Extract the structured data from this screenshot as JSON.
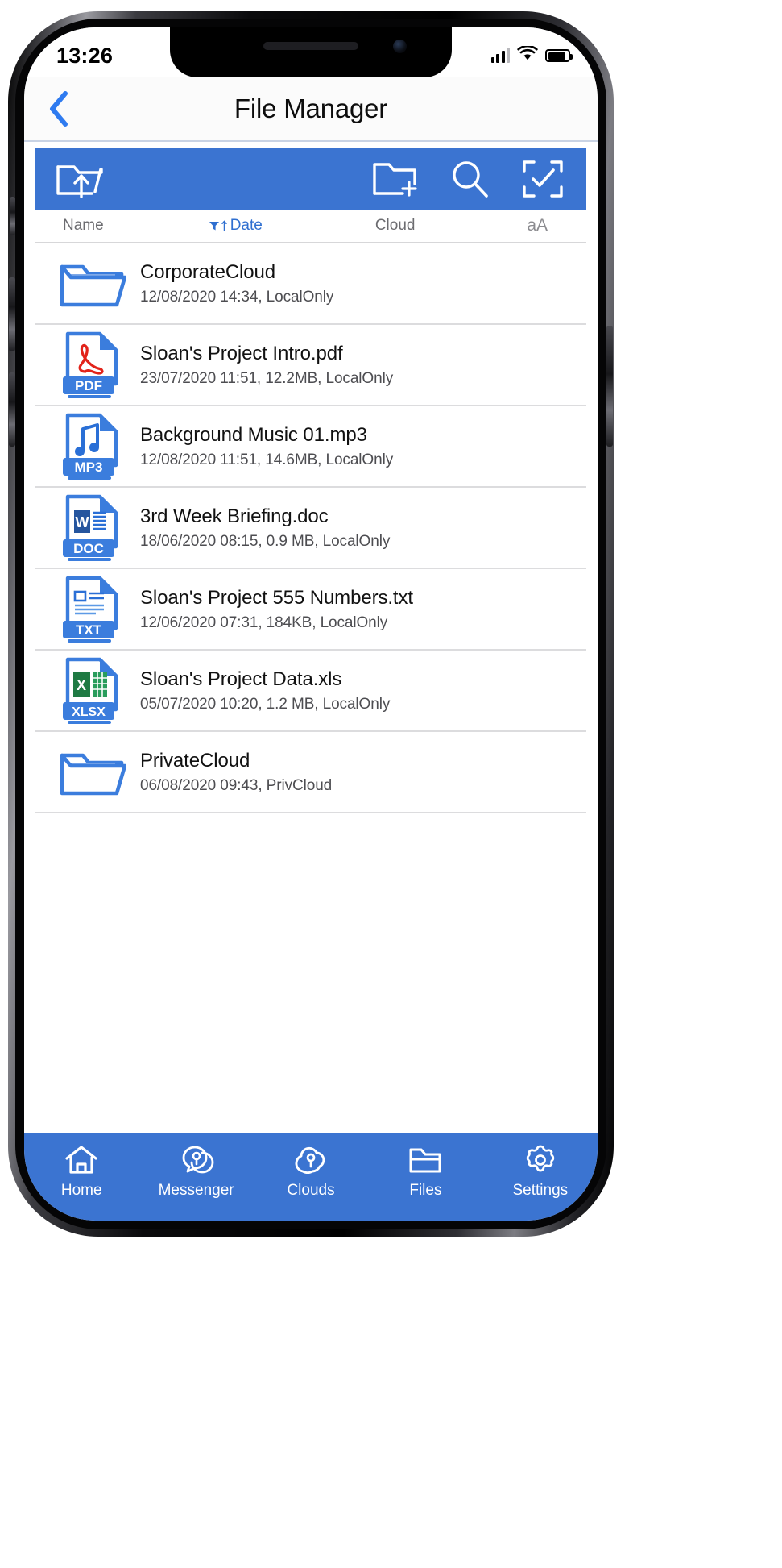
{
  "status_bar": {
    "time": "13:26",
    "signal_icon": "cellular-signal-icon",
    "wifi_icon": "wifi-icon",
    "battery_icon": "battery-icon"
  },
  "nav": {
    "back_icon": "chevron-left-icon",
    "title": "File Manager"
  },
  "toolbar": {
    "upload_label": "folder-upload-icon",
    "new_folder_label": "new-folder-icon",
    "search_label": "search-icon",
    "select_label": "select-all-icon"
  },
  "columns": {
    "name": "Name",
    "date": "Date",
    "cloud": "Cloud",
    "textsize": "aA",
    "sort_active": "date"
  },
  "files": [
    {
      "name": "CorporateCloud",
      "meta": "12/08/2020 14:34, LocalOnly",
      "icon": "folder-icon",
      "type": "folder",
      "date": "12/08/2020 14:34",
      "size": "",
      "cloud": "LocalOnly",
      "badge": ""
    },
    {
      "name": "Sloan's Project Intro.pdf",
      "meta": "23/07/2020 11:51, 12.2MB, LocalOnly",
      "icon": "pdf-file-icon",
      "type": "pdf",
      "date": "23/07/2020 11:51",
      "size": "12.2MB",
      "cloud": "LocalOnly",
      "badge": "PDF"
    },
    {
      "name": "Background Music 01.mp3",
      "meta": "12/08/2020 11:51, 14.6MB, LocalOnly",
      "icon": "mp3-file-icon",
      "type": "mp3",
      "date": "12/08/2020 11:51",
      "size": "14.6MB",
      "cloud": "LocalOnly",
      "badge": "MP3"
    },
    {
      "name": "3rd Week Briefing.doc",
      "meta": "18/06/2020 08:15, 0.9 MB, LocalOnly",
      "icon": "doc-file-icon",
      "type": "doc",
      "date": "18/06/2020 08:15",
      "size": "0.9 MB",
      "cloud": "LocalOnly",
      "badge": "DOC"
    },
    {
      "name": "Sloan's Project 555 Numbers.txt",
      "meta": "12/06/2020 07:31, 184KB, LocalOnly",
      "icon": "txt-file-icon",
      "type": "txt",
      "date": "12/06/2020 07:31",
      "size": "184KB",
      "cloud": "LocalOnly",
      "badge": "TXT"
    },
    {
      "name": "Sloan's Project Data.xls",
      "meta": "05/07/2020 10:20, 1.2 MB, LocalOnly",
      "icon": "xlsx-file-icon",
      "type": "xlsx",
      "date": "05/07/2020 10:20",
      "size": "1.2 MB",
      "cloud": "LocalOnly",
      "badge": "XLSX"
    },
    {
      "name": "PrivateCloud",
      "meta": "06/08/2020 09:43, PrivCloud",
      "icon": "folder-icon",
      "type": "folder",
      "date": "06/08/2020 09:43",
      "size": "",
      "cloud": "PrivCloud",
      "badge": ""
    }
  ],
  "tabs": [
    {
      "label": "Home",
      "icon": "home-icon"
    },
    {
      "label": "Messenger",
      "icon": "messenger-icon"
    },
    {
      "label": "Clouds",
      "icon": "cloud-key-icon"
    },
    {
      "label": "Files",
      "icon": "folder-icon"
    },
    {
      "label": "Settings",
      "icon": "gear-icon"
    }
  ],
  "colors": {
    "accent_blue": "#3b74d1",
    "link_blue": "#2f6fd0",
    "folder_blue": "#3b7ddd",
    "excel_green": "#1f7a43",
    "pdf_red": "#e2231a",
    "page_bg": "#ffffff"
  }
}
